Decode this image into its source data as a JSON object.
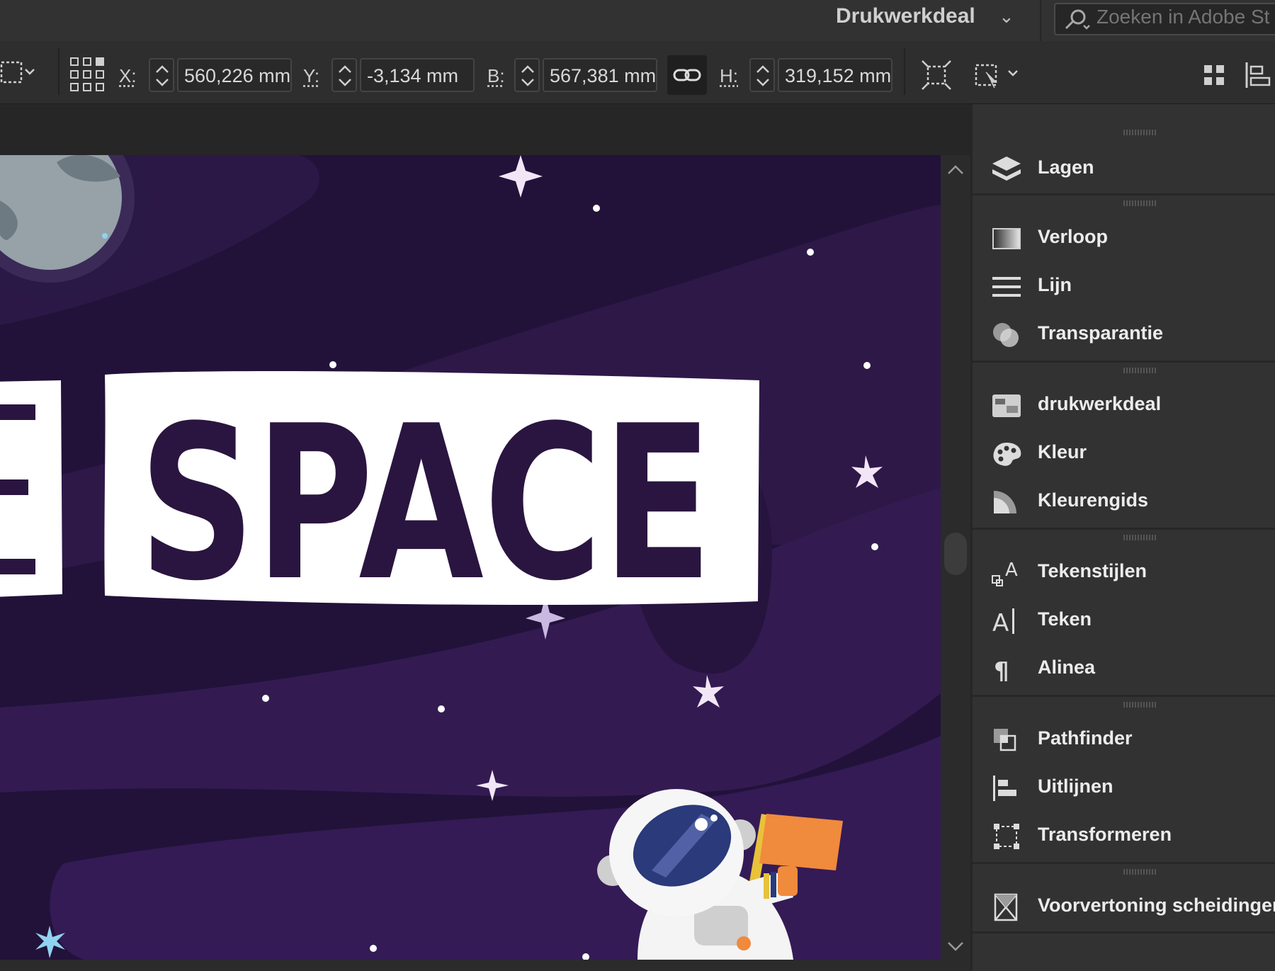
{
  "app_bar": {
    "workspace_label": "Drukwerkdeal",
    "search": {
      "placeholder": "Zoeken in Adobe St",
      "value": ""
    }
  },
  "control_bar": {
    "x": {
      "label": "X:",
      "value": "560,226 mm"
    },
    "y": {
      "label": "Y:",
      "value": "-3,134 mm"
    },
    "w": {
      "label": "B:",
      "value": "567,381 mm"
    },
    "h": {
      "label": "H:",
      "value": "319,152 mm"
    }
  },
  "canvas": {
    "headline": "SPACE",
    "partial_letter": "E"
  },
  "panel": {
    "groups": [
      [
        {
          "label": "Lagen",
          "icon": "layers-icon"
        }
      ],
      [
        {
          "label": "Verloop",
          "icon": "gradient-icon"
        },
        {
          "label": "Lijn",
          "icon": "stroke-icon"
        },
        {
          "label": "Transparantie",
          "icon": "transparency-icon"
        }
      ],
      [
        {
          "label": "drukwerkdeal",
          "icon": "library-icon"
        },
        {
          "label": "Kleur",
          "icon": "palette-icon"
        },
        {
          "label": "Kleurengids",
          "icon": "color-guide-icon"
        }
      ],
      [
        {
          "label": "Tekenstijlen",
          "icon": "character-styles-icon"
        },
        {
          "label": "Teken",
          "icon": "character-icon"
        },
        {
          "label": "Alinea",
          "icon": "paragraph-icon"
        }
      ],
      [
        {
          "label": "Pathfinder",
          "icon": "pathfinder-icon"
        },
        {
          "label": "Uitlijnen",
          "icon": "align-icon"
        },
        {
          "label": "Transformeren",
          "icon": "transform-icon"
        }
      ],
      [
        {
          "label": "Voorvertoning scheidingen",
          "icon": "separations-preview-icon"
        }
      ]
    ]
  },
  "colors": {
    "canvas_bg": "#231338",
    "nebula": "#3a1f55",
    "label_box": "#ffffff",
    "ink": "#2a1540",
    "flag": "#f08a3c"
  }
}
